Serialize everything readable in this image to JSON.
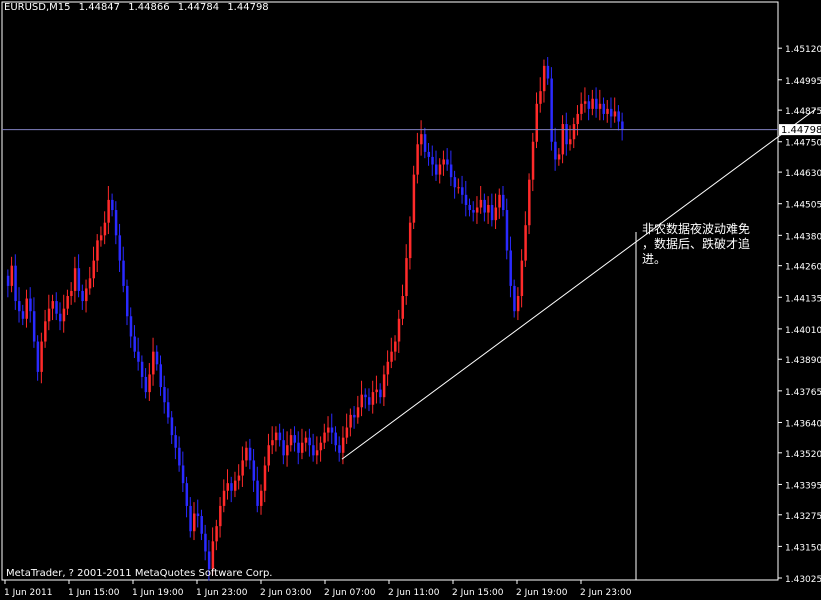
{
  "header": {
    "symbol": "EURUSD,M15",
    "open": "1.44847",
    "high": "1.44866",
    "low": "1.44784",
    "close": "1.44798"
  },
  "annotation": "非农数据夜波动难免\n，数据后、跌破才追\n进。",
  "copyright": "MetaTrader, ? 2001-2011 MetaQuotes Software Corp.",
  "colors": {
    "background": "#000000",
    "bull": "#ff2a2a",
    "bear": "#2a2aff",
    "axis": "#ffffff",
    "line": "#ffffff",
    "current_price_line": "#8080c0"
  },
  "chart_data": {
    "type": "candlestick",
    "title": "EURUSD,M15",
    "y_ticks": [
      "1.45120",
      "1.44995",
      "1.44875",
      "1.44750",
      "1.44630",
      "1.44505",
      "1.44380",
      "1.44260",
      "1.44135",
      "1.44010",
      "1.43890",
      "1.43765",
      "1.43640",
      "1.43520",
      "1.43395",
      "1.43275",
      "1.43150",
      "1.43025"
    ],
    "x_ticks": [
      "1 Jun 2011",
      "1 Jun 15:00",
      "1 Jun 19:00",
      "1 Jun 23:00",
      "2 Jun 03:00",
      "2 Jun 07:00",
      "2 Jun 11:00",
      "2 Jun 15:00",
      "2 Jun 19:00",
      "2 Jun 23:00"
    ],
    "current_price": "1.44798",
    "ylim": [
      1.43025,
      1.4518
    ],
    "trendline": [
      [
        342,
        1.43495
      ],
      [
        816,
        1.4488
      ]
    ],
    "vertical_marker_x": 636,
    "closes": [
      1.4418,
      1.4426,
      1.4412,
      1.4408,
      1.4405,
      1.4413,
      1.4408,
      1.4396,
      1.4384,
      1.4396,
      1.4404,
      1.4409,
      1.4412,
      1.4407,
      1.4404,
      1.4409,
      1.4414,
      1.4416,
      1.4425,
      1.4416,
      1.4412,
      1.4417,
      1.4421,
      1.4428,
      1.4436,
      1.4438,
      1.4443,
      1.4452,
      1.4448,
      1.4438,
      1.4428,
      1.4418,
      1.4406,
      1.4398,
      1.4392,
      1.4388,
      1.4382,
      1.4376,
      1.4383,
      1.4392,
      1.4387,
      1.4378,
      1.4372,
      1.4366,
      1.4359,
      1.4354,
      1.4347,
      1.434,
      1.4331,
      1.4321,
      1.4328,
      1.4327,
      1.432,
      1.4313,
      1.4306,
      1.4317,
      1.4323,
      1.4331,
      1.4337,
      1.434,
      1.4337,
      1.4341,
      1.4343,
      1.4349,
      1.4354,
      1.4349,
      1.4341,
      1.4331,
      1.4337,
      1.4347,
      1.4355,
      1.4357,
      1.436,
      1.4357,
      1.4351,
      1.4355,
      1.4359,
      1.4356,
      1.4352,
      1.4356,
      1.4358,
      1.4355,
      1.4351,
      1.4353,
      1.4356,
      1.436,
      1.4362,
      1.436,
      1.4355,
      1.4352,
      1.4358,
      1.4362,
      1.4367,
      1.4366,
      1.437,
      1.4375,
      1.4374,
      1.4371,
      1.4376,
      1.4377,
      1.4374,
      1.4383,
      1.4388,
      1.4392,
      1.4396,
      1.4405,
      1.4414,
      1.4429,
      1.4443,
      1.4462,
      1.4474,
      1.4478,
      1.4471,
      1.4469,
      1.4466,
      1.4462,
      1.4466,
      1.4468,
      1.4466,
      1.4461,
      1.4457,
      1.4457,
      1.4454,
      1.445,
      1.4448,
      1.4447,
      1.4449,
      1.4452,
      1.4447,
      1.445,
      1.4444,
      1.4449,
      1.4454,
      1.4448,
      1.4432,
      1.4418,
      1.4408,
      1.4414,
      1.4428,
      1.4442,
      1.446,
      1.4475,
      1.449,
      1.4495,
      1.4505,
      1.45,
      1.4475,
      1.4468,
      1.447,
      1.4482,
      1.4474,
      1.4476,
      1.4482,
      1.4486,
      1.449,
      1.4491,
      1.4488,
      1.4492,
      1.4488,
      1.449,
      1.4486,
      1.4488,
      1.4485,
      1.4487,
      1.4483,
      1.448
    ]
  }
}
